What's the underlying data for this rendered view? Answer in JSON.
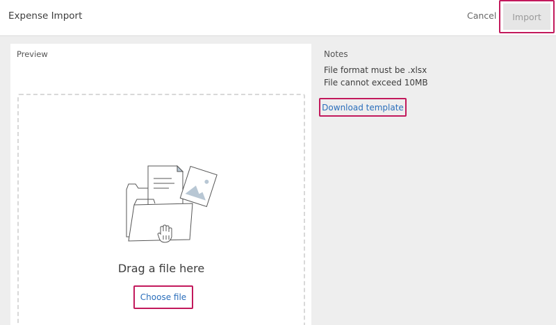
{
  "header": {
    "title": "Expense Import",
    "cancel_label": "Cancel",
    "import_label": "Import"
  },
  "preview": {
    "label": "Preview",
    "drag_text": "Drag a file here",
    "choose_label": "Choose file"
  },
  "notes": {
    "title": "Notes",
    "lines": [
      "File format must be .xlsx",
      "File cannot exceed 10MB"
    ],
    "download_label": "Download template"
  },
  "colors": {
    "highlight": "#c2185b",
    "link": "#2a6ebb",
    "illustration_accent": "#b8c7d4"
  },
  "icons": {
    "illustration": "folder-documents-hand-icon"
  }
}
